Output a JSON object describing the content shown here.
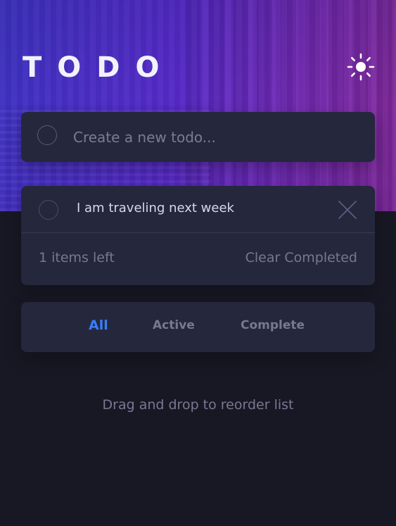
{
  "header": {
    "title": "TODO",
    "theme_icon": "sun-icon"
  },
  "create": {
    "placeholder": "Create a new todo..."
  },
  "todos": [
    {
      "text": "I am traveling next week",
      "completed": false
    }
  ],
  "footer": {
    "items_left": "1 items left",
    "clear_completed": "Clear Completed"
  },
  "filters": {
    "all": "All",
    "active": "Active",
    "complete": "Complete",
    "selected": "All"
  },
  "hint": "Drag and drop to reorder list",
  "colors": {
    "accent": "#3a7cfd",
    "card": "#25273c",
    "background": "#181824",
    "muted_text": "#767992"
  }
}
